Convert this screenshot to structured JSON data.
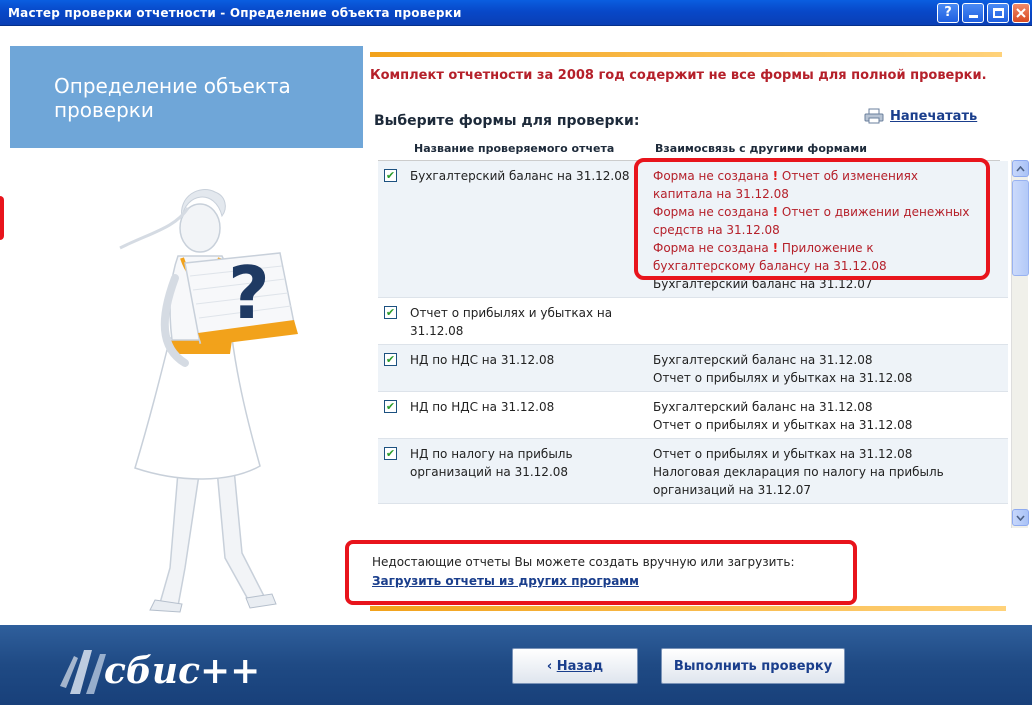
{
  "window": {
    "title": "Мастер проверки отчетности - Определение объекта проверки",
    "help_label": "?"
  },
  "left_panel": {
    "title_line1": "Определение объекта",
    "title_line2": "проверки"
  },
  "main": {
    "warning": "Комплект отчетности за 2008 год содержит не все формы для полной проверки.",
    "choose_label": "Выберите формы для проверки:",
    "print_label": "Напечатать",
    "columns": [
      "Название проверяемого отчета",
      "Взаимосвязь с другими формами"
    ],
    "rows": [
      {
        "checked": true,
        "name": "Бухгалтерский баланс на 31.12.08",
        "relations": [
          {
            "type": "missing",
            "prefix": "Форма не создана",
            "text": "Отчет об изменениях капитала на 31.12.08"
          },
          {
            "type": "missing",
            "prefix": "Форма не создана",
            "text": "Отчет о движении денежных средств на 31.12.08"
          },
          {
            "type": "missing",
            "prefix": "Форма не создана",
            "text": "Приложение к бухгалтерскому балансу на 31.12.08"
          },
          {
            "type": "ok",
            "text": "Бухгалтерский баланс на 31.12.07"
          }
        ]
      },
      {
        "checked": true,
        "name": "Отчет о прибылях и убытках на 31.12.08",
        "relations": []
      },
      {
        "checked": true,
        "name": "НД по НДС на 31.12.08",
        "relations": [
          {
            "type": "ok",
            "text": "Бухгалтерский баланс на 31.12.08"
          },
          {
            "type": "ok",
            "text": "Отчет о прибылях и убытках на 31.12.08"
          }
        ]
      },
      {
        "checked": true,
        "name": "НД по НДС на 31.12.08",
        "relations": [
          {
            "type": "ok",
            "text": "Бухгалтерский баланс на 31.12.08"
          },
          {
            "type": "ok",
            "text": "Отчет о прибылях и убытках на 31.12.08"
          }
        ]
      },
      {
        "checked": true,
        "name": "НД по налогу на прибыль организаций на 31.12.08",
        "relations": [
          {
            "type": "ok",
            "text": "Отчет о прибылях и убытках на 31.12.08"
          },
          {
            "type": "ok",
            "text": "Налоговая декларация по налогу на прибыль организаций на 31.12.07"
          }
        ]
      }
    ],
    "note": "Недостающие отчеты Вы можете создать вручную или загрузить:",
    "load_link": "Загрузить отчеты из других программ"
  },
  "footer": {
    "logo_text": "сбис++",
    "back_prefix": "‹ ",
    "back_label": "Назад",
    "run_label": "Выполнить проверку"
  },
  "colors": {
    "accent_orange": "#f2a21b",
    "warning_red": "#b5202a",
    "highlight_red": "#e8141c",
    "header_blue": "#6fa6d8"
  }
}
